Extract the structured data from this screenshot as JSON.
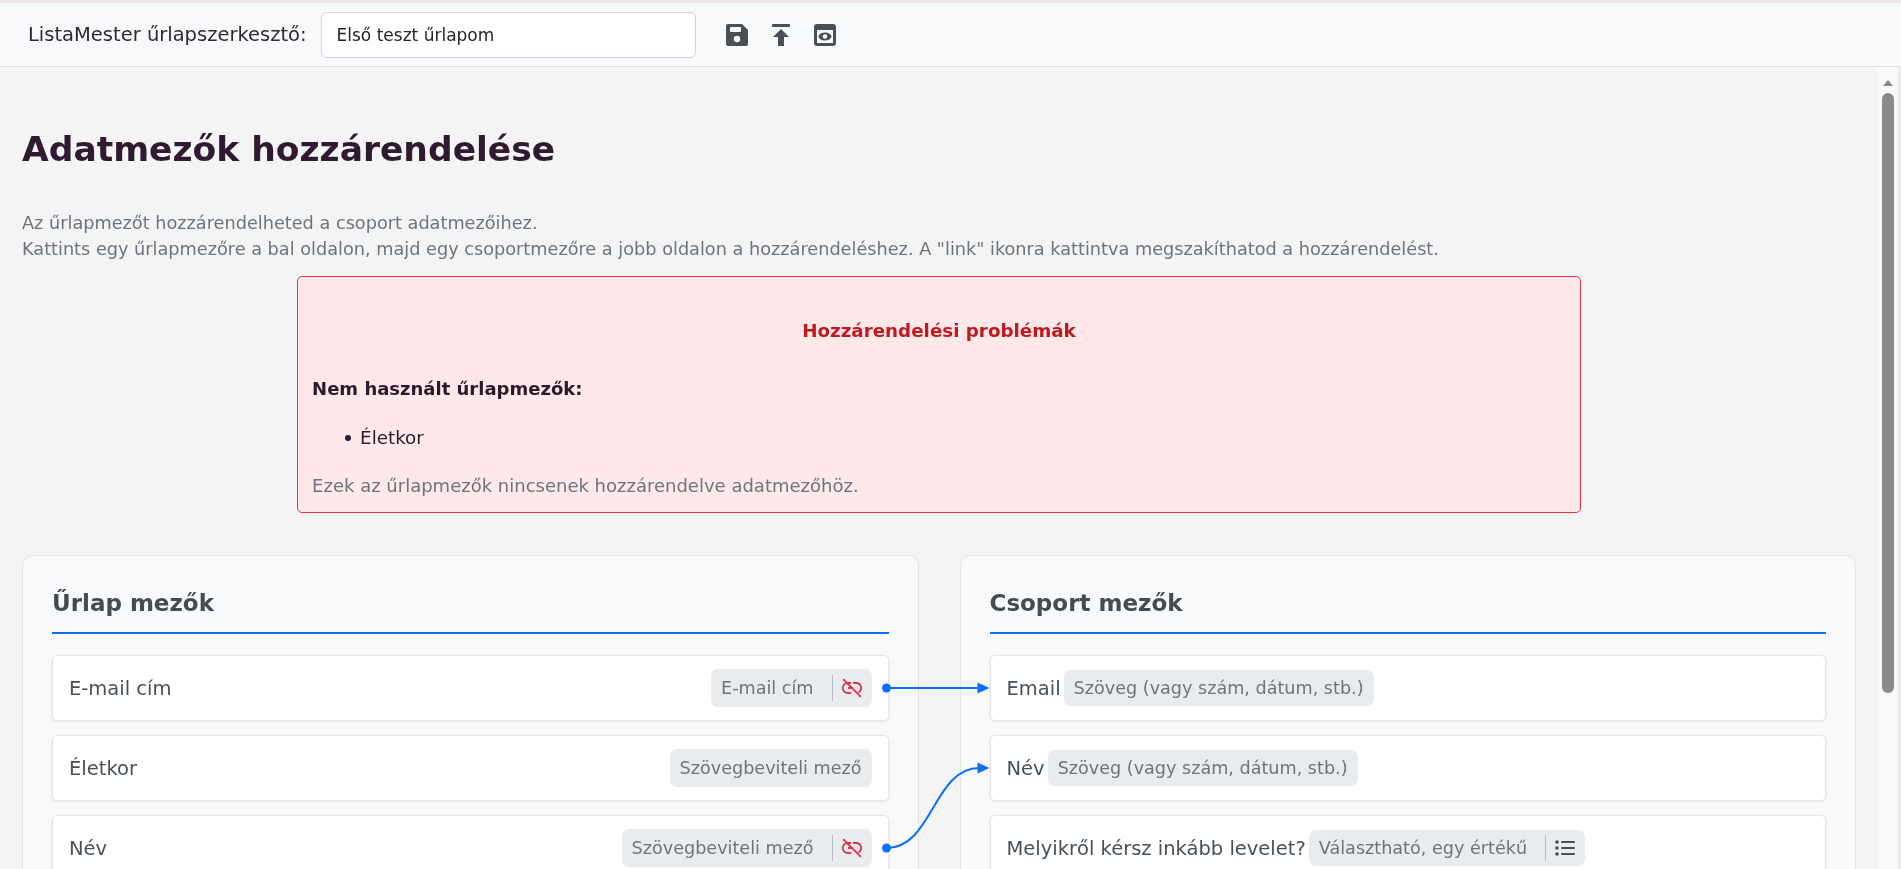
{
  "toolbar": {
    "label": "ListaMester űrlapszerkesztő:",
    "form_name": "Első teszt űrlapom"
  },
  "page": {
    "title": "Adatmezők hozzárendelése",
    "description": [
      "Az űrlapmezőt hozzárendelheted a csoport adatmezőihez.",
      "Kattints egy űrlapmezőre a bal oldalon, majd egy csoportmezőre a jobb oldalon a hozzárendeléshez. A \"link\" ikonra kattintva megszakíthatod a hozzárendelést."
    ]
  },
  "alert": {
    "title": "Hozzárendelési problémák",
    "subtitle": "Nem használt űrlapmezők:",
    "items": [
      "Életkor"
    ],
    "note": "Ezek az űrlapmezők nincsenek hozzárendelve adatmezőhöz."
  },
  "form_panel": {
    "title": "Űrlap mezők",
    "fields": [
      {
        "label": "E-mail cím",
        "type": "E-mail cím",
        "linked": true
      },
      {
        "label": "Életkor",
        "type": "Szövegbeviteli mező",
        "linked": false
      },
      {
        "label": "Név",
        "type": "Szövegbeviteli mező",
        "linked": true
      }
    ]
  },
  "group_panel": {
    "title": "Csoport mezők",
    "fields": [
      {
        "label": "Email",
        "type": "Szöveg (vagy szám, dátum, stb.)",
        "kind": "text",
        "linked": true
      },
      {
        "label": "Név",
        "type": "Szöveg (vagy szám, dátum, stb.)",
        "kind": "text",
        "linked": true
      },
      {
        "label": "Melyikről kérsz inkább levelet?",
        "type": "Választható, egy értékű",
        "kind": "choice",
        "linked": false
      }
    ]
  }
}
